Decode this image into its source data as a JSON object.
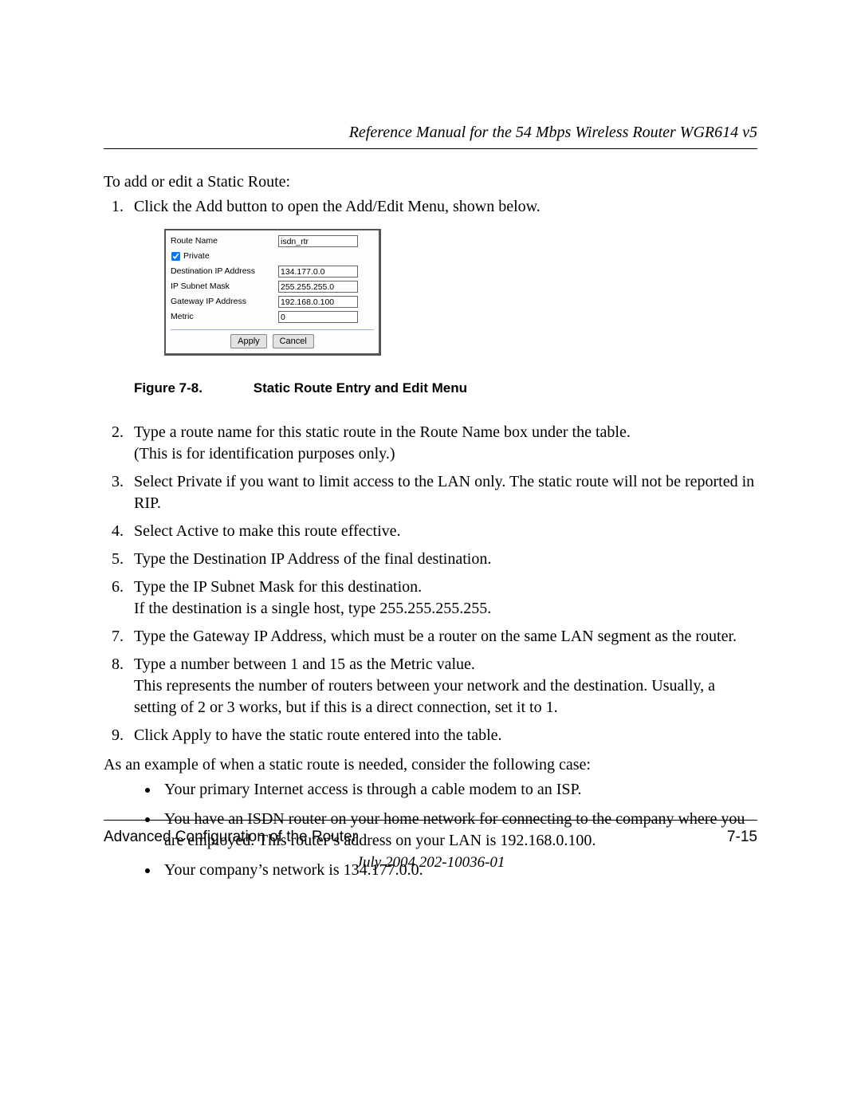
{
  "header": {
    "running_title": "Reference Manual for the 54 Mbps Wireless Router WGR614 v5"
  },
  "intro": "To add or edit a Static Route:",
  "step1": "Click the Add button to open the Add/Edit Menu, shown below.",
  "figure": {
    "route_name_label": "Route Name",
    "route_name_value": "isdn_rtr",
    "private_label": "Private",
    "dest_ip_label": "Destination IP Address",
    "dest_ip_value": "134.177.0.0",
    "subnet_label": "IP Subnet Mask",
    "subnet_value": "255.255.255.0",
    "gateway_label": "Gateway IP Address",
    "gateway_value": "192.168.0.100",
    "metric_label": "Metric",
    "metric_value": "0",
    "apply_btn": "Apply",
    "cancel_btn": "Cancel",
    "caption_num": "Figure 7-8.",
    "caption_text": "Static Route Entry and Edit Menu"
  },
  "steps_rest": {
    "s2a": "Type a route name for this static route in the Route Name box under the table.",
    "s2b": "(This is for identification purposes only.)",
    "s3": "Select Private if you want to limit access to the LAN only. The static route will not be reported in RIP.",
    "s4": "Select Active to make this route effective.",
    "s5": "Type the Destination IP Address of the final destination.",
    "s6a": "Type the IP Subnet Mask for this destination.",
    "s6b": "If the destination is a single host, type 255.255.255.255.",
    "s7": "Type the Gateway IP Address, which must be a router on the same LAN segment as the router.",
    "s8a": "Type a number between 1 and 15 as the Metric value.",
    "s8b": "This represents the number of routers between your network and the destination. Usually, a setting of 2 or 3 works, but if this is a direct connection, set it to 1.",
    "s9": "Click Apply to have the static route entered into the table."
  },
  "example_intro": "As an example of when a static route is needed, consider the following case:",
  "bullets": {
    "b1": "Your primary Internet access is through a cable modem to an ISP.",
    "b2": "You have an ISDN router on your home network for connecting to the company where you are employed. This router’s address on your LAN is 192.168.0.100.",
    "b3": "Your company’s network is 134.177.0.0."
  },
  "footer": {
    "section": "Advanced Configuration of the Router",
    "page": "7-15",
    "date": "July 2004 202-10036-01"
  }
}
